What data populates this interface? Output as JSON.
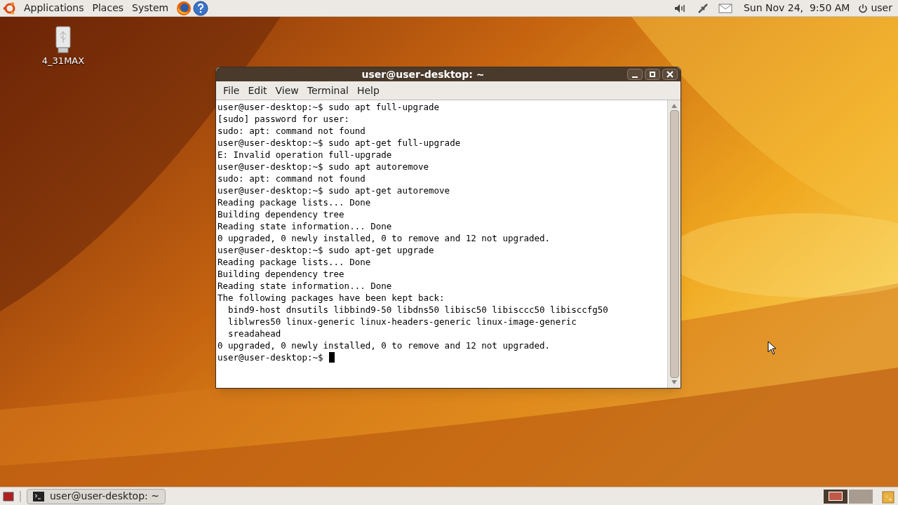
{
  "top_panel": {
    "menus": [
      "Applications",
      "Places",
      "System"
    ],
    "clock": "Sun Nov 24,  9:50 AM",
    "user": "user"
  },
  "desktop_icons": [
    {
      "label": "4_31MAX"
    }
  ],
  "window": {
    "title": "user@user-desktop: ~",
    "menu": [
      "File",
      "Edit",
      "View",
      "Terminal",
      "Help"
    ],
    "lines": [
      "user@user-desktop:~$ sudo apt full-upgrade",
      "[sudo] password for user:",
      "sudo: apt: command not found",
      "user@user-desktop:~$ sudo apt-get full-upgrade",
      "E: Invalid operation full-upgrade",
      "user@user-desktop:~$ sudo apt autoremove",
      "sudo: apt: command not found",
      "user@user-desktop:~$ sudo apt-get autoremove",
      "Reading package lists... Done",
      "Building dependency tree",
      "Reading state information... Done",
      "0 upgraded, 0 newly installed, 0 to remove and 12 not upgraded.",
      "user@user-desktop:~$ sudo apt-get upgrade",
      "Reading package lists... Done",
      "Building dependency tree",
      "Reading state information... Done",
      "The following packages have been kept back:",
      "  bind9-host dnsutils libbind9-50 libdns50 libisc50 libisccc50 libisccfg50",
      "  liblwres50 linux-generic linux-headers-generic linux-image-generic",
      "  sreadahead",
      "0 upgraded, 0 newly installed, 0 to remove and 12 not upgraded.",
      "user@user-desktop:~$"
    ]
  },
  "bottom_panel": {
    "tasks": [
      {
        "label": "user@user-desktop: ~",
        "selected": false
      }
    ],
    "workspaces": [
      {
        "selected": true
      },
      {
        "selected": false
      }
    ]
  }
}
